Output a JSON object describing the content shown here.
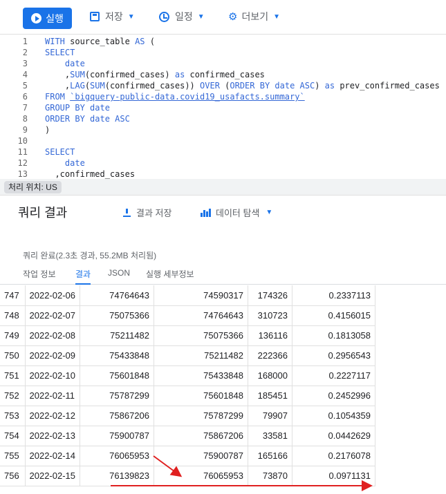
{
  "toolbar": {
    "run_label": "실행",
    "save_label": "저장",
    "schedule_label": "일정",
    "more_label": "더보기"
  },
  "editor": {
    "lines": [
      {
        "num": "1",
        "parts": [
          [
            "kw",
            "WITH"
          ],
          [
            "t",
            " source_table "
          ],
          [
            "kw",
            "AS"
          ],
          [
            "t",
            " ("
          ]
        ]
      },
      {
        "num": "2",
        "parts": [
          [
            "kw",
            "SELECT"
          ]
        ]
      },
      {
        "num": "3",
        "parts": [
          [
            "t",
            "    "
          ],
          [
            "kw",
            "date"
          ]
        ]
      },
      {
        "num": "4",
        "parts": [
          [
            "t",
            "    ,"
          ],
          [
            "kw",
            "SUM"
          ],
          [
            "t",
            "(confirmed_cases) "
          ],
          [
            "kw",
            "as"
          ],
          [
            "t",
            " confirmed_cases"
          ]
        ]
      },
      {
        "num": "5",
        "parts": [
          [
            "t",
            "    ,"
          ],
          [
            "kw",
            "LAG"
          ],
          [
            "t",
            "("
          ],
          [
            "kw",
            "SUM"
          ],
          [
            "t",
            "(confirmed_cases)) "
          ],
          [
            "kw",
            "OVER"
          ],
          [
            "t",
            " ("
          ],
          [
            "kw",
            "ORDER BY"
          ],
          [
            "t",
            " "
          ],
          [
            "kw",
            "date ASC"
          ],
          [
            "t",
            ") "
          ],
          [
            "kw",
            "as"
          ],
          [
            "t",
            " prev_confirmed_cases"
          ]
        ]
      },
      {
        "num": "6",
        "parts": [
          [
            "kw",
            "FROM"
          ],
          [
            "t",
            " "
          ],
          [
            "tbl",
            "`bigquery-public-data.covid19_usafacts.summary`"
          ]
        ]
      },
      {
        "num": "7",
        "parts": [
          [
            "kw",
            "GROUP BY"
          ],
          [
            "t",
            " "
          ],
          [
            "kw",
            "date"
          ]
        ]
      },
      {
        "num": "8",
        "parts": [
          [
            "kw",
            "ORDER BY"
          ],
          [
            "t",
            " "
          ],
          [
            "kw",
            "date ASC"
          ]
        ]
      },
      {
        "num": "9",
        "parts": [
          [
            "t",
            ")"
          ]
        ]
      },
      {
        "num": "10",
        "parts": []
      },
      {
        "num": "11",
        "parts": [
          [
            "kw",
            "SELECT"
          ]
        ]
      },
      {
        "num": "12",
        "parts": [
          [
            "t",
            "    "
          ],
          [
            "kw",
            "date"
          ]
        ]
      },
      {
        "num": "13",
        "parts": [
          [
            "t",
            "  ,confirmed_cases"
          ]
        ]
      }
    ]
  },
  "location": "처리 위치: US",
  "results": {
    "title": "쿼리 결과",
    "save_label": "결과 저장",
    "explore_label": "데이터 탐색",
    "status": "쿼리 완료(2.3초 경과, 55.2MB 처리됨)",
    "tabs": [
      "작업 정보",
      "결과",
      "JSON",
      "실행 세부정보"
    ],
    "active_tab": 1
  },
  "table": {
    "rows": [
      [
        "747",
        "2022-02-06",
        "74764643",
        "74590317",
        "174326",
        "0.2337113"
      ],
      [
        "748",
        "2022-02-07",
        "75075366",
        "74764643",
        "310723",
        "0.4156015"
      ],
      [
        "749",
        "2022-02-08",
        "75211482",
        "75075366",
        "136116",
        "0.1813058"
      ],
      [
        "750",
        "2022-02-09",
        "75433848",
        "75211482",
        "222366",
        "0.2956543"
      ],
      [
        "751",
        "2022-02-10",
        "75601848",
        "75433848",
        "168000",
        "0.2227117"
      ],
      [
        "752",
        "2022-02-11",
        "75787299",
        "75601848",
        "185451",
        "0.2452996"
      ],
      [
        "753",
        "2022-02-12",
        "75867206",
        "75787299",
        "79907",
        "0.1054359"
      ],
      [
        "754",
        "2022-02-13",
        "75900787",
        "75867206",
        "33581",
        "0.0442629"
      ],
      [
        "755",
        "2022-02-14",
        "76065953",
        "75900787",
        "165166",
        "0.2176078"
      ],
      [
        "756",
        "2022-02-15",
        "76139823",
        "76065953",
        "73870",
        "0.0971131"
      ]
    ]
  },
  "annotation_color": "#e02020"
}
